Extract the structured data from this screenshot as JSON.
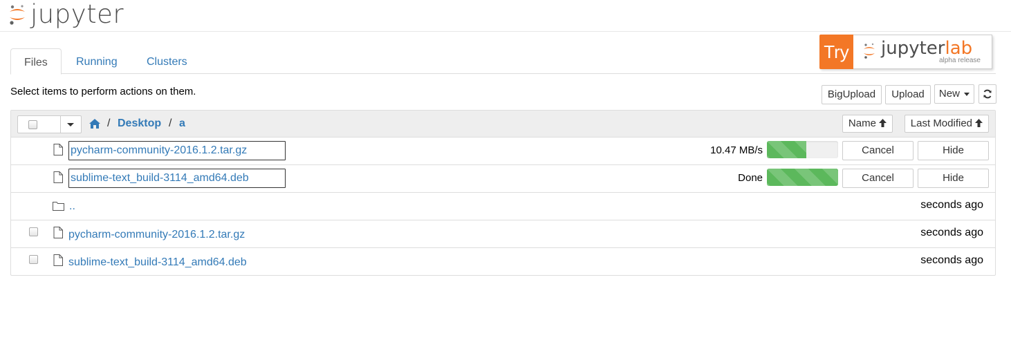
{
  "header": {
    "logo_text": "jupyter"
  },
  "try_lab": {
    "try_label": "Try",
    "name_main": "jupyter",
    "name_suffix": "lab",
    "subtitle": "alpha release"
  },
  "tabs": [
    {
      "label": "Files",
      "active": true
    },
    {
      "label": "Running",
      "active": false
    },
    {
      "label": "Clusters",
      "active": false
    }
  ],
  "instructions": "Select items to perform actions on them.",
  "toolbar": {
    "bigupload_label": "BigUpload",
    "upload_label": "Upload",
    "new_label": "New",
    "refresh_icon": "refresh-icon"
  },
  "breadcrumb": {
    "home_icon": "home-icon",
    "separator": "/",
    "items": [
      "Desktop",
      "a"
    ]
  },
  "sort": {
    "name_label": "Name",
    "last_modified_label": "Last Modified"
  },
  "uploads": [
    {
      "filename": "pycharm-community-2016.1.2.tar.gz",
      "status": "10.47 MB/s",
      "progress": 0.55,
      "cancel_label": "Cancel",
      "hide_label": "Hide"
    },
    {
      "filename": "sublime-text_build-3114_amd64.deb",
      "status": "Done",
      "progress": 1.0,
      "cancel_label": "Cancel",
      "hide_label": "Hide"
    }
  ],
  "items": [
    {
      "type": "folder",
      "name": "..",
      "modified": "seconds ago"
    },
    {
      "type": "file",
      "name": "pycharm-community-2016.1.2.tar.gz",
      "modified": "seconds ago"
    },
    {
      "type": "file",
      "name": "sublime-text_build-3114_amd64.deb",
      "modified": "seconds ago"
    }
  ],
  "colors": {
    "accent": "#337ab7",
    "jupyter_orange": "#f37726",
    "progress_green": "#5cb85c"
  }
}
